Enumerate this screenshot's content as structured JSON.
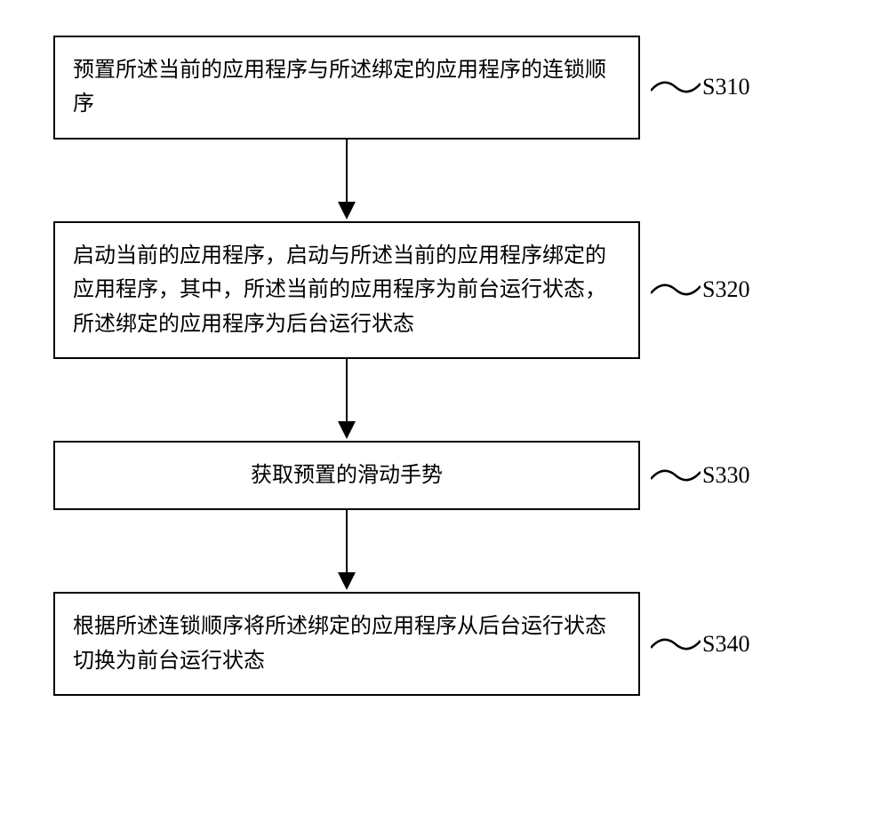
{
  "steps": [
    {
      "text": "预置所述当前的应用程序与所述绑定的应用程序的连锁顺序",
      "label": "S310",
      "centered": false
    },
    {
      "text": "启动当前的应用程序，启动与所述当前的应用程序绑定的应用程序，其中，所述当前的应用程序为前台运行状态，所述绑定的应用程序为后台运行状态",
      "label": "S320",
      "centered": false
    },
    {
      "text": "获取预置的滑动手势",
      "label": "S330",
      "centered": true
    },
    {
      "text": "根据所述连锁顺序将所述绑定的应用程序从后台运行状态切换为前台运行状态",
      "label": "S340",
      "centered": false
    }
  ]
}
